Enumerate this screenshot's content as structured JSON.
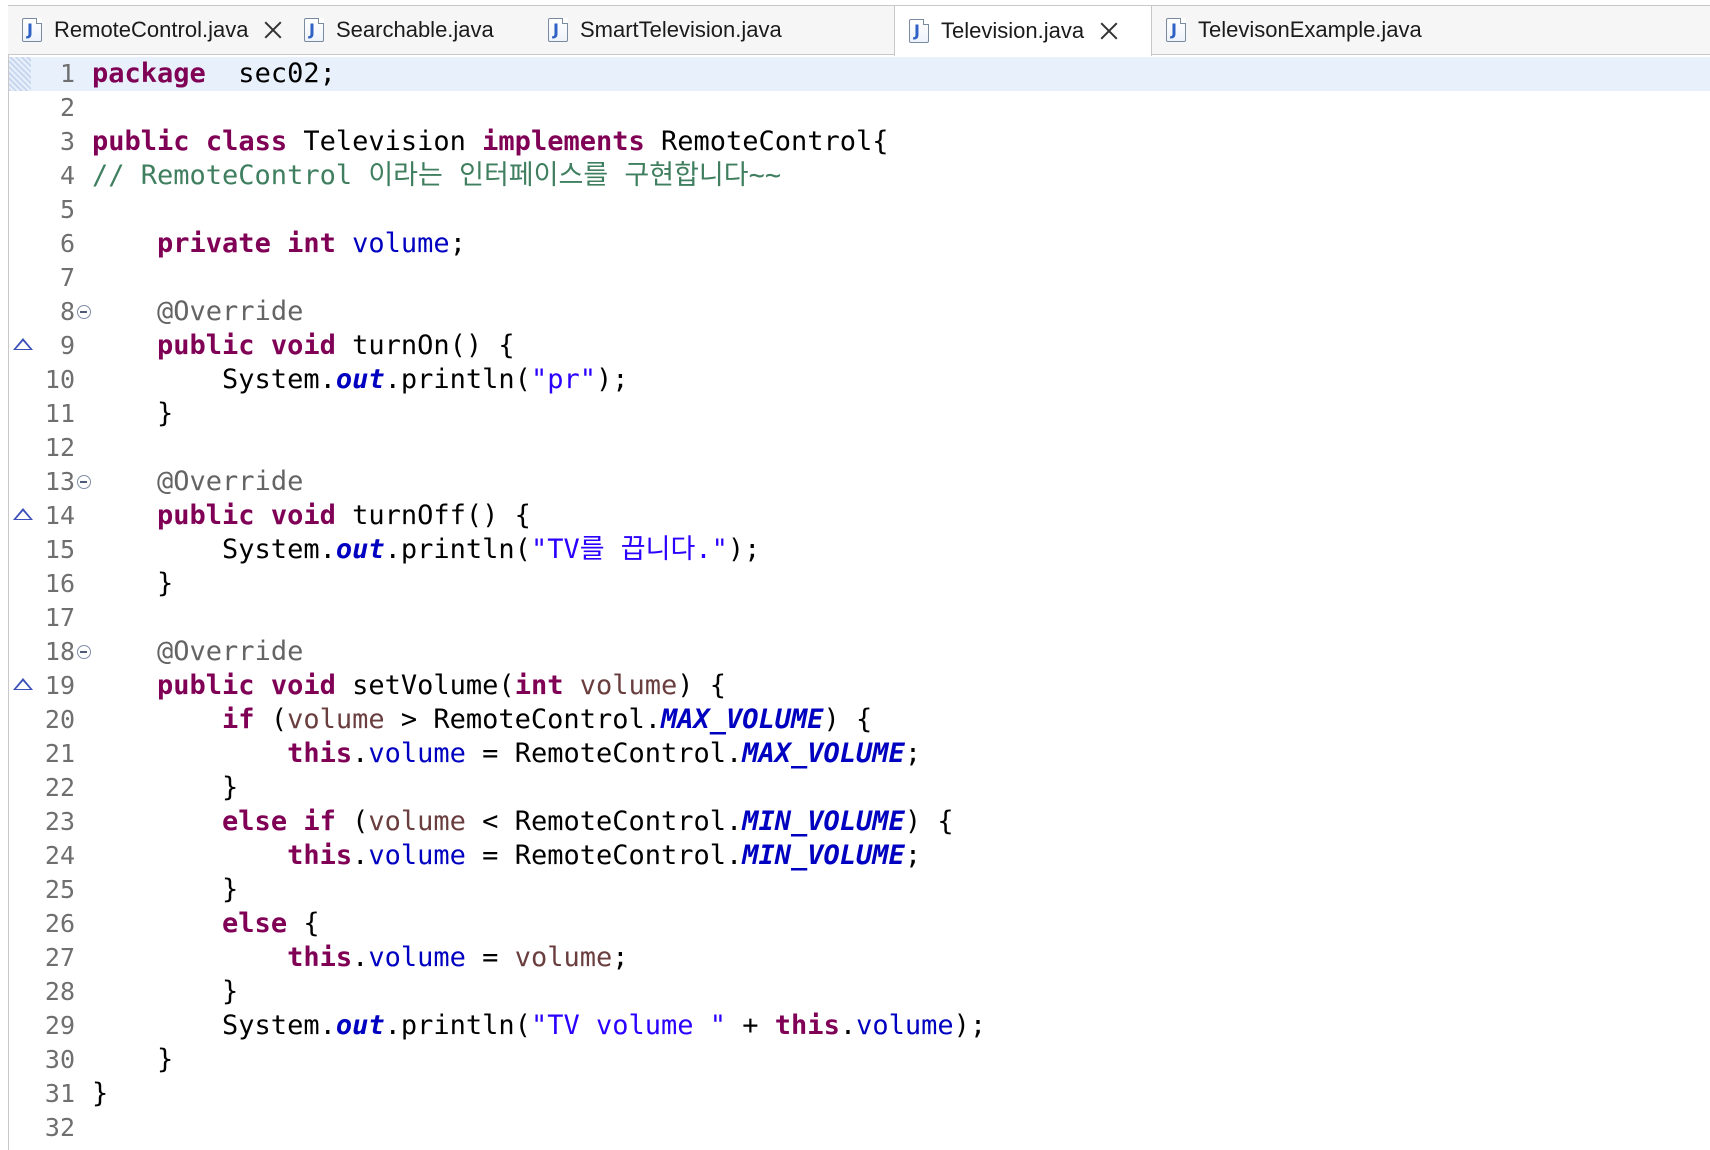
{
  "tabs": [
    {
      "label": "RemoteControl.java",
      "closable": true
    },
    {
      "label": "Searchable.java",
      "closable": false
    },
    {
      "label": "SmartTelevision.java",
      "closable": false
    },
    {
      "label": "Television.java",
      "closable": true,
      "active": true
    },
    {
      "label": "TelevisonExample.java",
      "closable": false
    }
  ],
  "editor": {
    "current_line": 1,
    "lines": [
      {
        "n": "1",
        "tokens": [
          [
            "kw",
            "package"
          ],
          [
            "",
            "  sec02;"
          ]
        ]
      },
      {
        "n": "2",
        "tokens": []
      },
      {
        "n": "3",
        "tokens": [
          [
            "kw",
            "public"
          ],
          [
            "",
            " "
          ],
          [
            "kw",
            "class"
          ],
          [
            "",
            " Television "
          ],
          [
            "kw",
            "implements"
          ],
          [
            "",
            " RemoteControl{"
          ]
        ]
      },
      {
        "n": "4",
        "tokens": [
          [
            "cm",
            "// RemoteControl 이라는 인터페이스를 구현합니다~~"
          ]
        ]
      },
      {
        "n": "5",
        "tokens": []
      },
      {
        "n": "6",
        "tokens": [
          [
            "",
            "    "
          ],
          [
            "kw",
            "private"
          ],
          [
            "",
            " "
          ],
          [
            "kw",
            "int"
          ],
          [
            "",
            " "
          ],
          [
            "fld",
            "volume"
          ],
          [
            "",
            ";"
          ]
        ]
      },
      {
        "n": "7",
        "tokens": []
      },
      {
        "n": "8",
        "fold": true,
        "tokens": [
          [
            "",
            "    "
          ],
          [
            "ann",
            "@Override"
          ]
        ]
      },
      {
        "n": "9",
        "override": true,
        "tokens": [
          [
            "",
            "    "
          ],
          [
            "kw",
            "public"
          ],
          [
            "",
            " "
          ],
          [
            "kw",
            "void"
          ],
          [
            "",
            " turnOn() {"
          ]
        ]
      },
      {
        "n": "10",
        "tokens": [
          [
            "",
            "        System."
          ],
          [
            "sfld",
            "out"
          ],
          [
            "",
            ".println("
          ],
          [
            "str",
            "\"pr\""
          ],
          [
            "",
            ");"
          ]
        ]
      },
      {
        "n": "11",
        "tokens": [
          [
            "",
            "    }"
          ]
        ]
      },
      {
        "n": "12",
        "tokens": []
      },
      {
        "n": "13",
        "fold": true,
        "tokens": [
          [
            "",
            "    "
          ],
          [
            "ann",
            "@Override"
          ]
        ]
      },
      {
        "n": "14",
        "override": true,
        "tokens": [
          [
            "",
            "    "
          ],
          [
            "kw",
            "public"
          ],
          [
            "",
            " "
          ],
          [
            "kw",
            "void"
          ],
          [
            "",
            " turnOff() {"
          ]
        ]
      },
      {
        "n": "15",
        "tokens": [
          [
            "",
            "        System."
          ],
          [
            "sfld",
            "out"
          ],
          [
            "",
            ".println("
          ],
          [
            "str",
            "\"TV를 끕니다.\""
          ],
          [
            "",
            ");"
          ]
        ]
      },
      {
        "n": "16",
        "tokens": [
          [
            "",
            "    }"
          ]
        ]
      },
      {
        "n": "17",
        "tokens": []
      },
      {
        "n": "18",
        "fold": true,
        "tokens": [
          [
            "",
            "    "
          ],
          [
            "ann",
            "@Override"
          ]
        ]
      },
      {
        "n": "19",
        "override": true,
        "tokens": [
          [
            "",
            "    "
          ],
          [
            "kw",
            "public"
          ],
          [
            "",
            " "
          ],
          [
            "kw",
            "void"
          ],
          [
            "",
            " setVolume("
          ],
          [
            "kw",
            "int"
          ],
          [
            "",
            " "
          ],
          [
            "param",
            "volume"
          ],
          [
            "",
            ") {"
          ]
        ]
      },
      {
        "n": "20",
        "tokens": [
          [
            "",
            "        "
          ],
          [
            "kw",
            "if"
          ],
          [
            "",
            " ("
          ],
          [
            "param",
            "volume"
          ],
          [
            "",
            " > RemoteControl."
          ],
          [
            "sfld",
            "MAX_VOLUME"
          ],
          [
            "",
            ") {"
          ]
        ]
      },
      {
        "n": "21",
        "tokens": [
          [
            "",
            "            "
          ],
          [
            "kw",
            "this"
          ],
          [
            "",
            "."
          ],
          [
            "fld",
            "volume"
          ],
          [
            "",
            " = RemoteControl."
          ],
          [
            "sfld",
            "MAX_VOLUME"
          ],
          [
            "",
            ";"
          ]
        ]
      },
      {
        "n": "22",
        "tokens": [
          [
            "",
            "        }"
          ]
        ]
      },
      {
        "n": "23",
        "tokens": [
          [
            "",
            "        "
          ],
          [
            "kw",
            "else"
          ],
          [
            "",
            " "
          ],
          [
            "kw",
            "if"
          ],
          [
            "",
            " ("
          ],
          [
            "param",
            "volume"
          ],
          [
            "",
            " < RemoteControl."
          ],
          [
            "sfld",
            "MIN_VOLUME"
          ],
          [
            "",
            ") {"
          ]
        ]
      },
      {
        "n": "24",
        "tokens": [
          [
            "",
            "            "
          ],
          [
            "kw",
            "this"
          ],
          [
            "",
            "."
          ],
          [
            "fld",
            "volume"
          ],
          [
            "",
            " = RemoteControl."
          ],
          [
            "sfld",
            "MIN_VOLUME"
          ],
          [
            "",
            ";"
          ]
        ]
      },
      {
        "n": "25",
        "tokens": [
          [
            "",
            "        }"
          ]
        ]
      },
      {
        "n": "26",
        "tokens": [
          [
            "",
            "        "
          ],
          [
            "kw",
            "else"
          ],
          [
            "",
            " {"
          ]
        ]
      },
      {
        "n": "27",
        "tokens": [
          [
            "",
            "            "
          ],
          [
            "kw",
            "this"
          ],
          [
            "",
            "."
          ],
          [
            "fld",
            "volume"
          ],
          [
            "",
            " = "
          ],
          [
            "param",
            "volume"
          ],
          [
            "",
            ";"
          ]
        ]
      },
      {
        "n": "28",
        "tokens": [
          [
            "",
            "        }"
          ]
        ]
      },
      {
        "n": "29",
        "tokens": [
          [
            "",
            "        System."
          ],
          [
            "sfld",
            "out"
          ],
          [
            "",
            ".println("
          ],
          [
            "str",
            "\"TV volume \""
          ],
          [
            "",
            " + "
          ],
          [
            "kw",
            "this"
          ],
          [
            "",
            "."
          ],
          [
            "fld",
            "volume"
          ],
          [
            "",
            ");"
          ]
        ]
      },
      {
        "n": "30",
        "tokens": [
          [
            "",
            "    }"
          ]
        ]
      },
      {
        "n": "31",
        "tokens": [
          [
            "",
            "}"
          ]
        ]
      },
      {
        "n": "32",
        "tokens": []
      }
    ]
  }
}
